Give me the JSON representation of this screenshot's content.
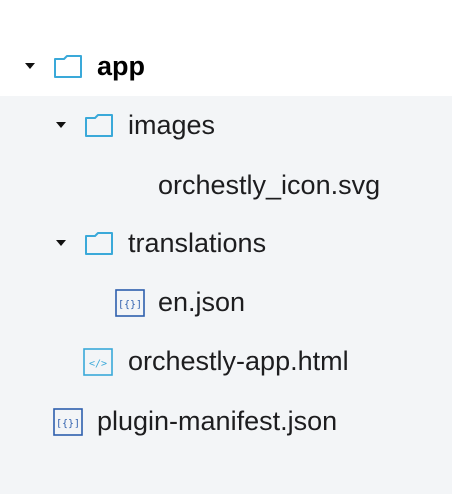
{
  "tree": {
    "root": {
      "label": "app",
      "expanded": true,
      "icon": "folder-icon"
    },
    "images_folder": {
      "label": "images",
      "expanded": true,
      "icon": "folder-icon"
    },
    "svg_file": {
      "label": "orchestly_icon.svg"
    },
    "translations_folder": {
      "label": "translations",
      "expanded": true,
      "icon": "folder-icon"
    },
    "en_json": {
      "label": "en.json",
      "icon": "json-file-icon"
    },
    "html_file": {
      "label": "orchestly-app.html",
      "icon": "html-file-icon"
    },
    "manifest": {
      "label": "plugin-manifest.json",
      "icon": "json-file-icon"
    }
  },
  "colors": {
    "folder_outline": "#3aa9d9",
    "json_icon": "#2e5fae",
    "html_icon": "#3aa9d9",
    "selected_row_bg": "#ffffff",
    "panel_bg": "#f3f5f7"
  }
}
